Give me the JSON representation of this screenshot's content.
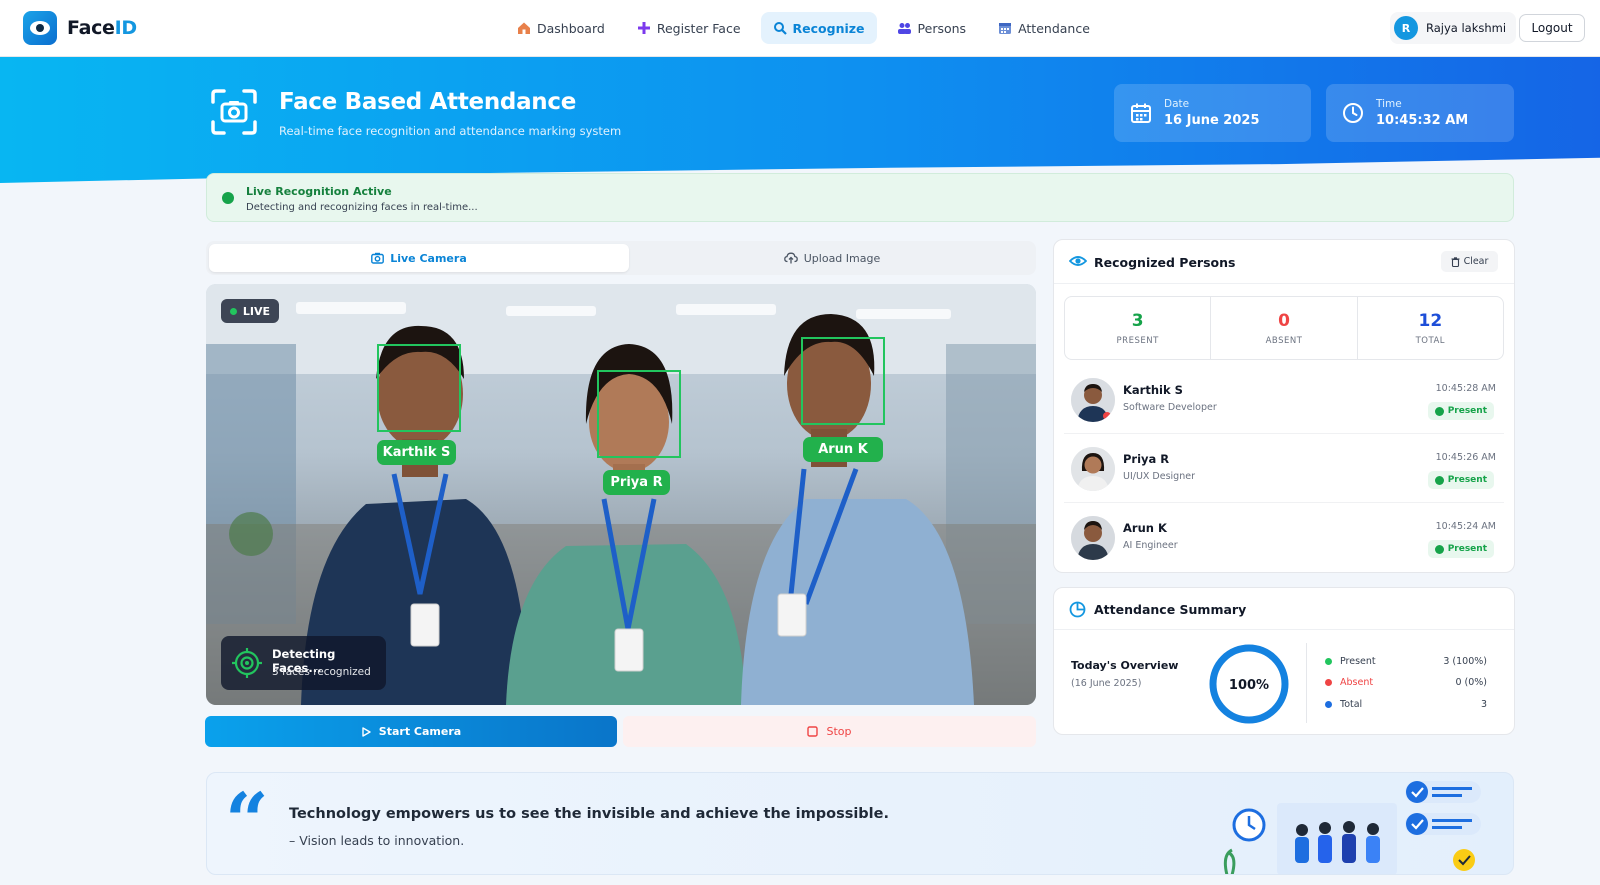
{
  "brand": {
    "name_main": "Face",
    "name_accent": "ID"
  },
  "nav": [
    {
      "label": "Dashboard",
      "icon": "home-icon",
      "active": false
    },
    {
      "label": "Register Face",
      "icon": "plus-icon",
      "active": false
    },
    {
      "label": "Recognize",
      "icon": "search-icon",
      "active": true
    },
    {
      "label": "Persons",
      "icon": "users-icon",
      "active": false
    },
    {
      "label": "Attendance",
      "icon": "calendar-icon",
      "active": false
    }
  ],
  "user": {
    "initial": "R",
    "name": "Rajya lakshmi",
    "logout_label": "Logout"
  },
  "hero": {
    "title": "Face Based Attendance",
    "subtitle": "Real-time face recognition and attendance marking system",
    "date_label": "Date",
    "date_value": "16 June 2025",
    "time_label": "Time",
    "time_value": "10:45:32 AM"
  },
  "status": {
    "title": "Live Recognition Active",
    "subtitle": "Detecting and recognizing faces in real-time..."
  },
  "tabs": {
    "live": "Live Camera",
    "upload": "Upload Image"
  },
  "camera": {
    "live_label": "LIVE",
    "faces": [
      "Karthik S",
      "Priya R",
      "Arun K"
    ],
    "detect_title": "Detecting Faces...",
    "detect_sub": "3 faces recognized"
  },
  "controls": {
    "start_label": "Start Camera",
    "stop_label": "Stop"
  },
  "recognized": {
    "title": "Recognized Persons",
    "clear_label": "Clear",
    "stats": [
      {
        "value": "3",
        "label": "PRESENT",
        "color": "#16a34a"
      },
      {
        "value": "0",
        "label": "ABSENT",
        "color": "#ef4444"
      },
      {
        "value": "12",
        "label": "TOTAL",
        "color": "#1d4ed8"
      }
    ],
    "persons": [
      {
        "name": "Karthik S",
        "role": "Software Developer",
        "time": "10:45:28 AM",
        "status": "Present"
      },
      {
        "name": "Priya R",
        "role": "UI/UX Designer",
        "time": "10:45:26 AM",
        "status": "Present"
      },
      {
        "name": "Arun K",
        "role": "AI Engineer",
        "time": "10:45:24 AM",
        "status": "Present"
      }
    ]
  },
  "summary": {
    "title": "Attendance Summary",
    "overview_label": "Today's Overview",
    "overview_date": "(16 June 2025)",
    "percent_label": "100%",
    "present_fraction": 1.0,
    "legend": [
      {
        "label": "Present",
        "value": "3 (100%)",
        "color": "#22c55e"
      },
      {
        "label": "Absent",
        "value": "0 (0%)",
        "color": "#ef4444"
      },
      {
        "label": "Total",
        "value": "3",
        "color": "#1d6ee0"
      }
    ]
  },
  "quote": {
    "text": "Technology empowers us to see the invisible and achieve the impossible.",
    "author": "– Vision leads to innovation."
  },
  "colors": {
    "accent": "#0a84d6",
    "present": "#16a34a",
    "absent": "#ef4444"
  }
}
